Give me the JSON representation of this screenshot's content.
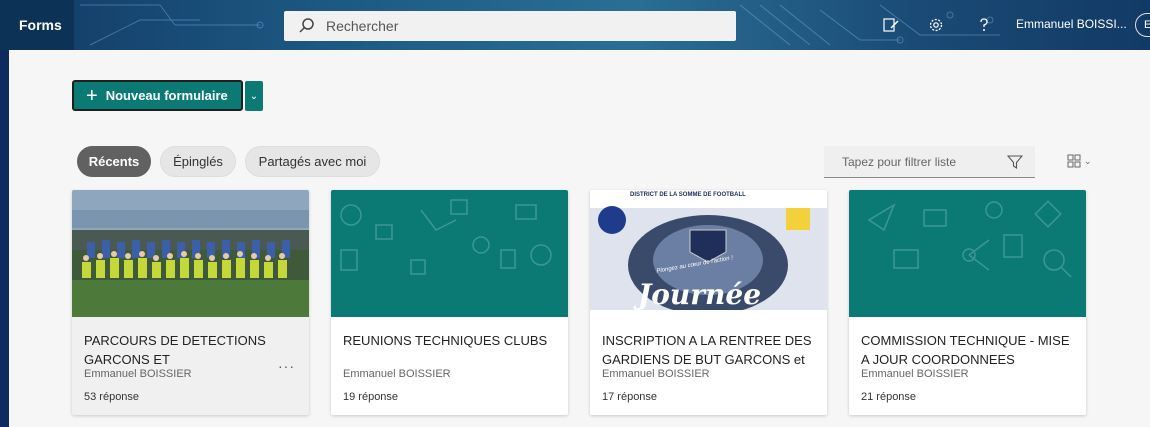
{
  "header": {
    "app_name": "Forms",
    "search_placeholder": "Rechercher",
    "user_name": "Emmanuel BOISSI...",
    "user_initial": "E"
  },
  "toolbar": {
    "new_form_label": "Nouveau formulaire"
  },
  "tabs": [
    {
      "label": "Récents",
      "active": true
    },
    {
      "label": "Épinglés",
      "active": false
    },
    {
      "label": "Partagés avec moi",
      "active": false
    }
  ],
  "filter": {
    "placeholder": "Tapez pour filtrer liste"
  },
  "cards": [
    {
      "title": "PARCOURS DE DETECTIONS GARCONS ET",
      "author": "Emmanuel BOISSIER",
      "responses": "53 réponse",
      "thumb": "photo"
    },
    {
      "title": "REUNIONS TECHNIQUES CLUBS",
      "author": "Emmanuel BOISSIER",
      "responses": "19 réponse",
      "thumb": "teal"
    },
    {
      "title": "INSCRIPTION A LA RENTREE DES GARDIENS DE BUT GARCONS et",
      "author": "Emmanuel BOISSIER",
      "responses": "17 réponse",
      "thumb": "poster",
      "poster_header": "DISTRICT DE LA SOMME DE FOOTBALL",
      "poster_text": "Journée",
      "poster_slogan": "Plongez au cœur de l'action !"
    },
    {
      "title": "COMMISSION TECHNIQUE - MISE A JOUR COORDONNEES",
      "author": "Emmanuel BOISSIER",
      "responses": "21 réponse",
      "thumb": "teal"
    }
  ],
  "colors": {
    "accent": "#0b7a75",
    "header_bg": "#1d5a83",
    "background": "#f6f6f6"
  },
  "icons": {
    "search": "search-icon",
    "header_actions": [
      "edit-icon",
      "gear-icon",
      "help-icon"
    ],
    "filter": "filter-icon",
    "view": "grid-view-icon",
    "more": "more-icon"
  }
}
